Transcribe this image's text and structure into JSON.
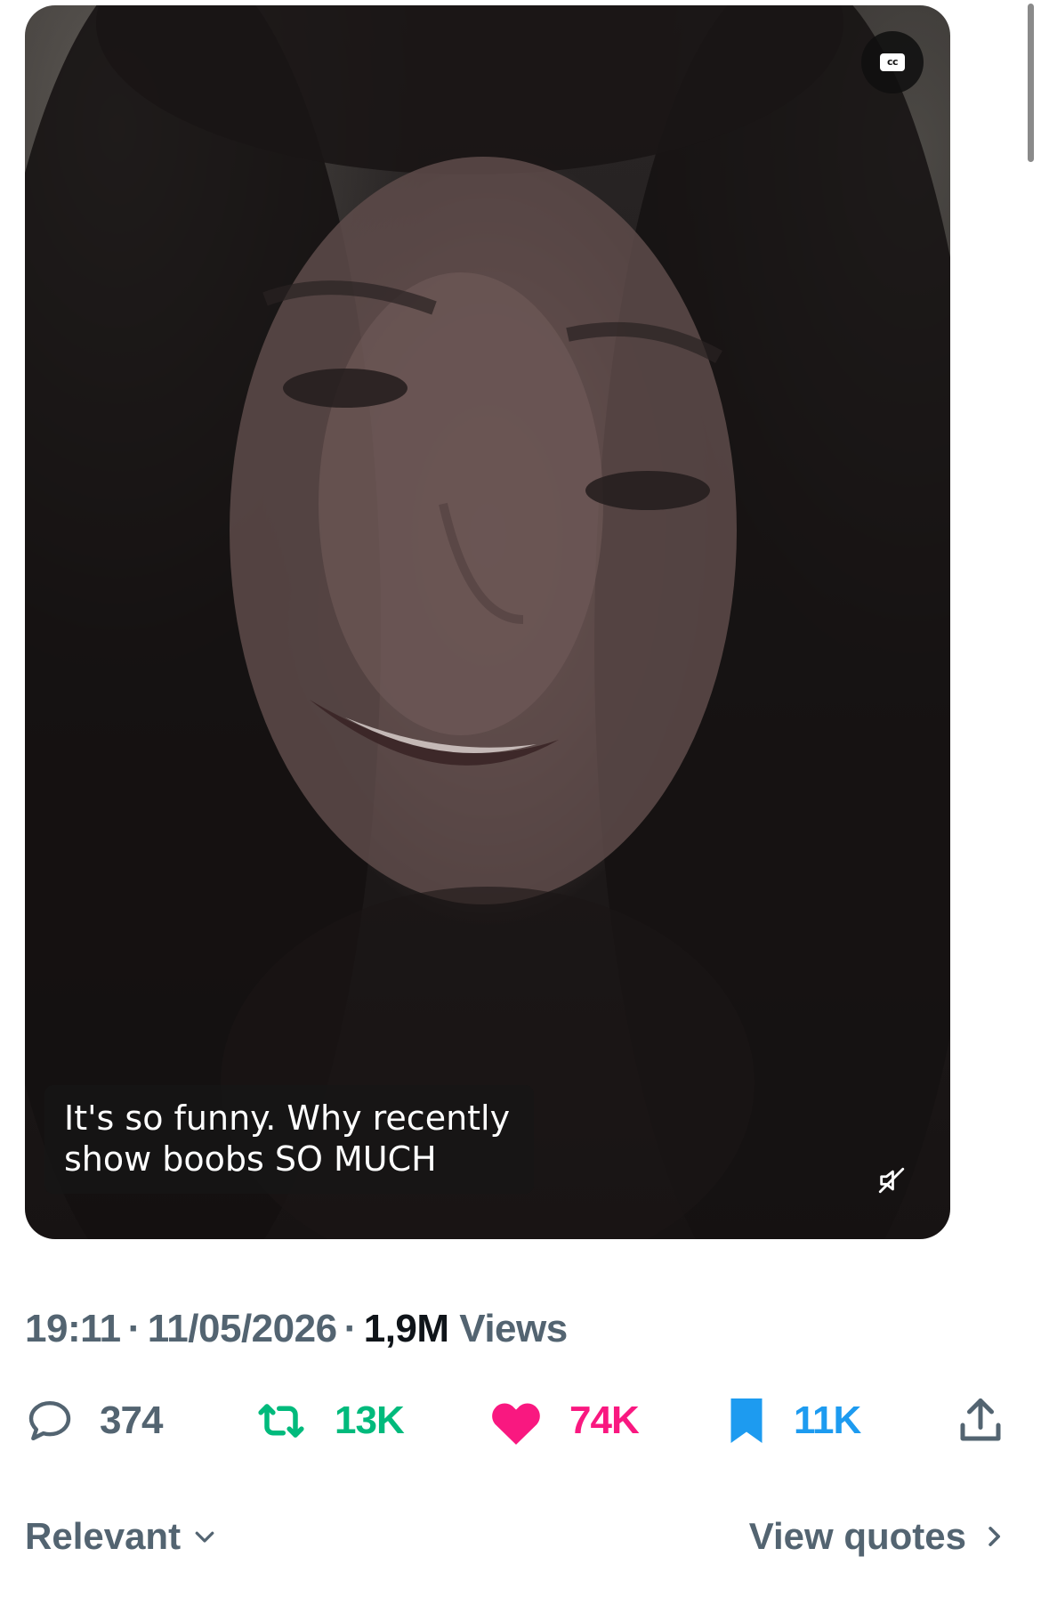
{
  "video": {
    "cc_label": "CC",
    "caption_line1": "It's so funny. Why recently",
    "caption_line2": "show boobs SO MUCH",
    "muted": true
  },
  "meta": {
    "time": "19:11",
    "date": "11/05/2026",
    "views_count": "1,9M",
    "views_label": "Views",
    "separator": "·"
  },
  "actions": {
    "replies": "374",
    "reposts": "13K",
    "likes": "74K",
    "bookmarks": "11K"
  },
  "footer": {
    "sort_label": "Relevant",
    "view_quotes_label": "View quotes"
  },
  "colors": {
    "secondary_text": "#536471",
    "repost": "#00ba7c",
    "like": "#f91880",
    "bookmark": "#1d9bf0"
  },
  "icons": [
    "closed-captions-icon",
    "speaker-muted-icon",
    "reply-bubble-icon",
    "repost-icon",
    "heart-icon",
    "bookmark-icon",
    "share-icon",
    "chevron-down-icon",
    "chevron-right-icon"
  ]
}
